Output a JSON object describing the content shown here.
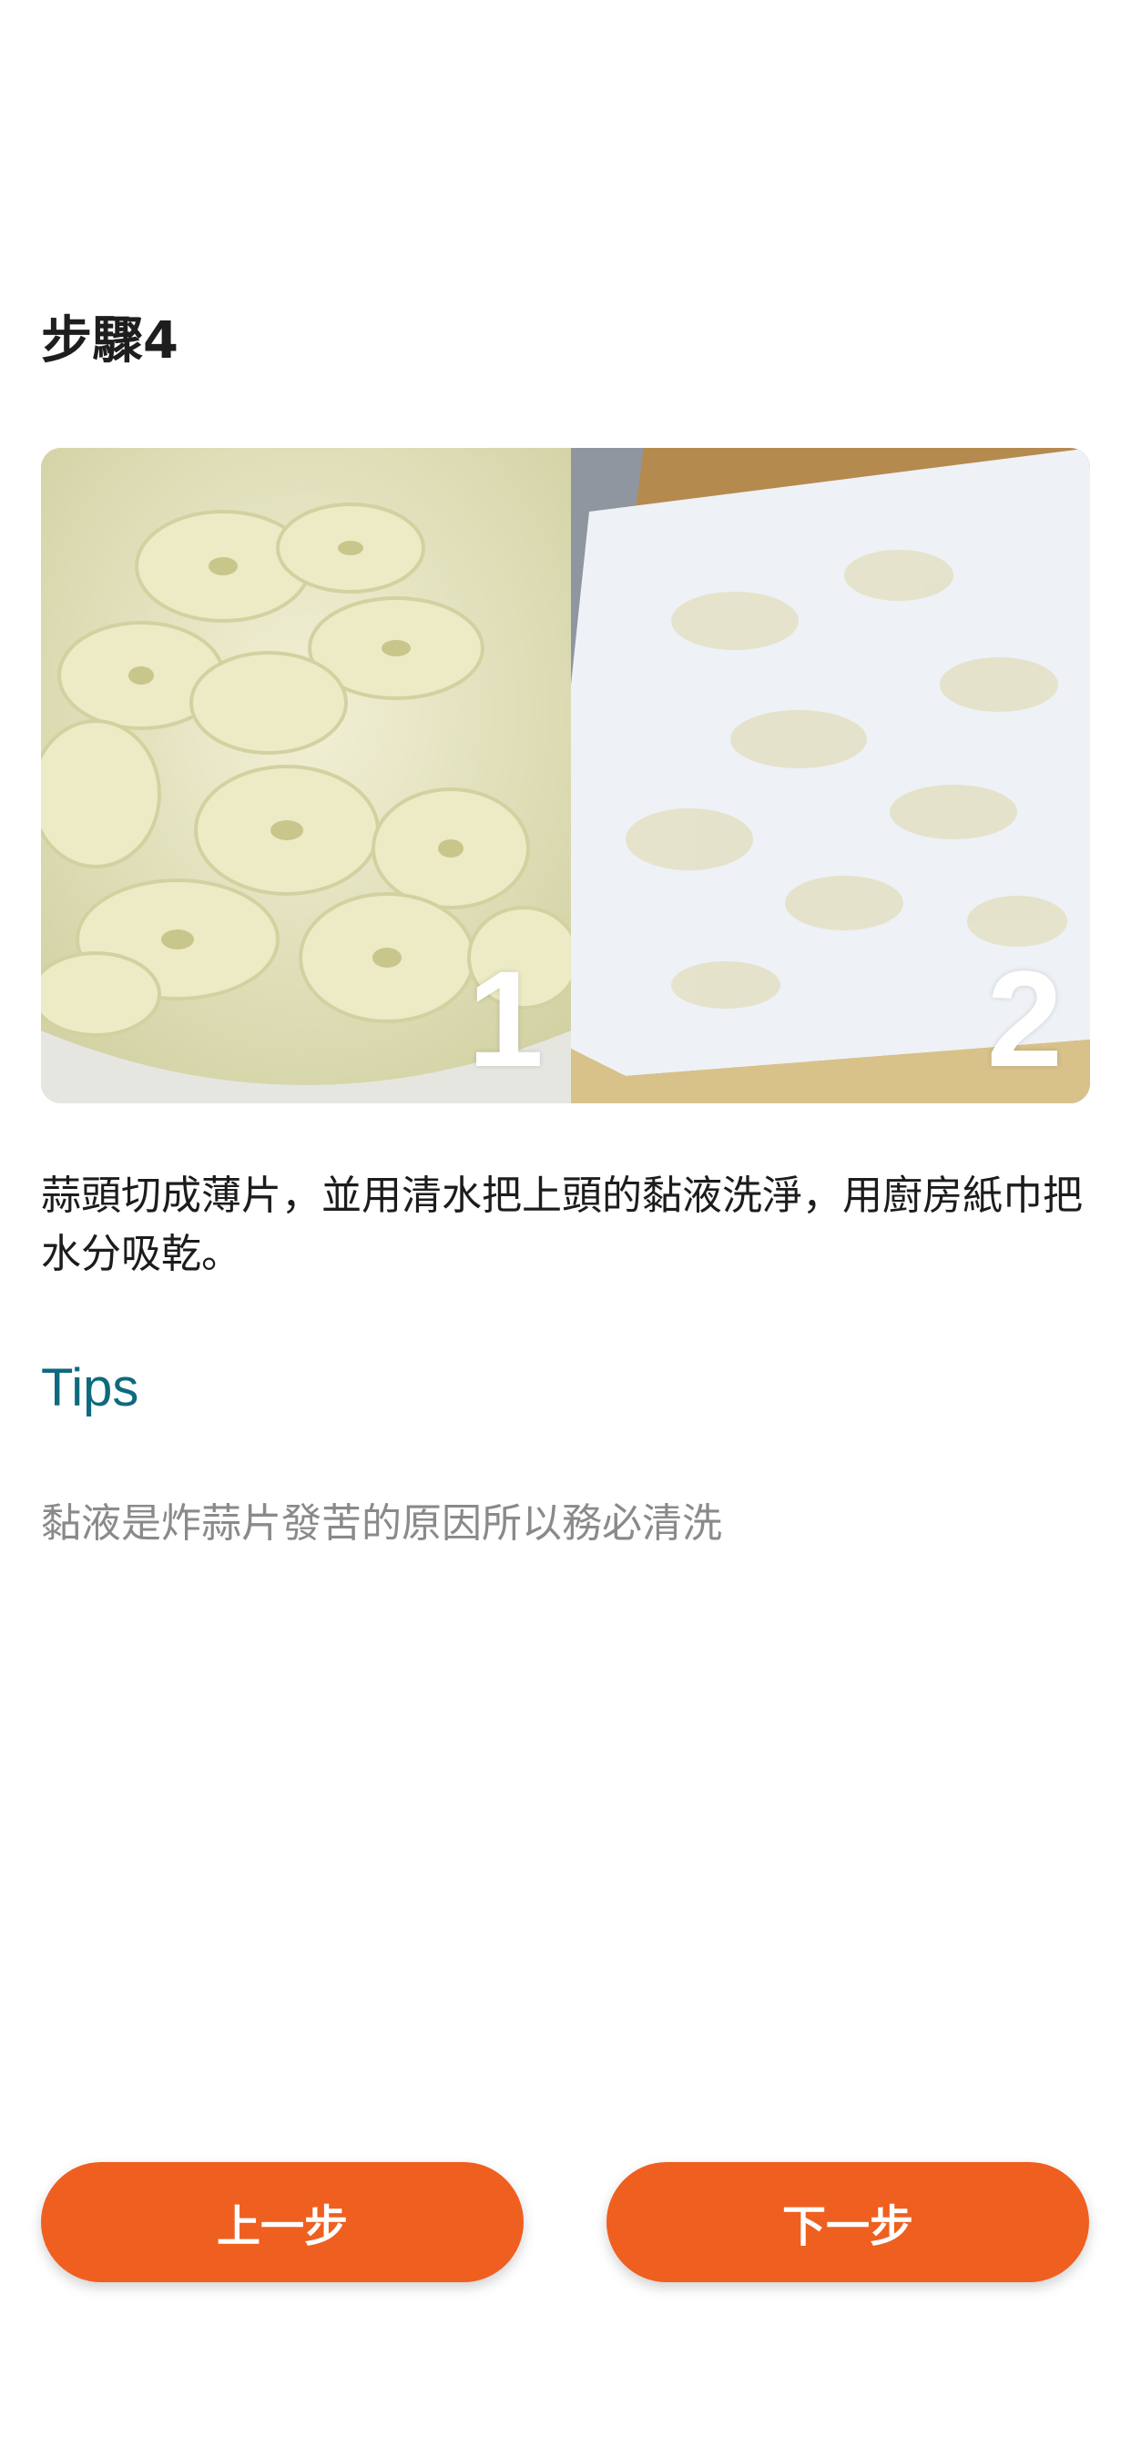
{
  "step": {
    "title": "步驟4",
    "image": {
      "panels": [
        {
          "number": "1",
          "subject": "sliced garlic in white bowl"
        },
        {
          "number": "2",
          "subject": "garlic slices on kitchen paper towel"
        }
      ]
    },
    "description": "蒜頭切成薄片，並用清水把上頭的黏液洗淨，用廚房紙巾把水分吸乾。"
  },
  "tips": {
    "title": "Tips",
    "text": "黏液是炸蒜片發苦的原因所以務必清洗"
  },
  "nav": {
    "prev_label": "上一步",
    "next_label": "下一步"
  },
  "colors": {
    "accent": "#ef5f1f",
    "tips_title": "#0e6a7e",
    "tips_text": "#8a8a8a"
  }
}
